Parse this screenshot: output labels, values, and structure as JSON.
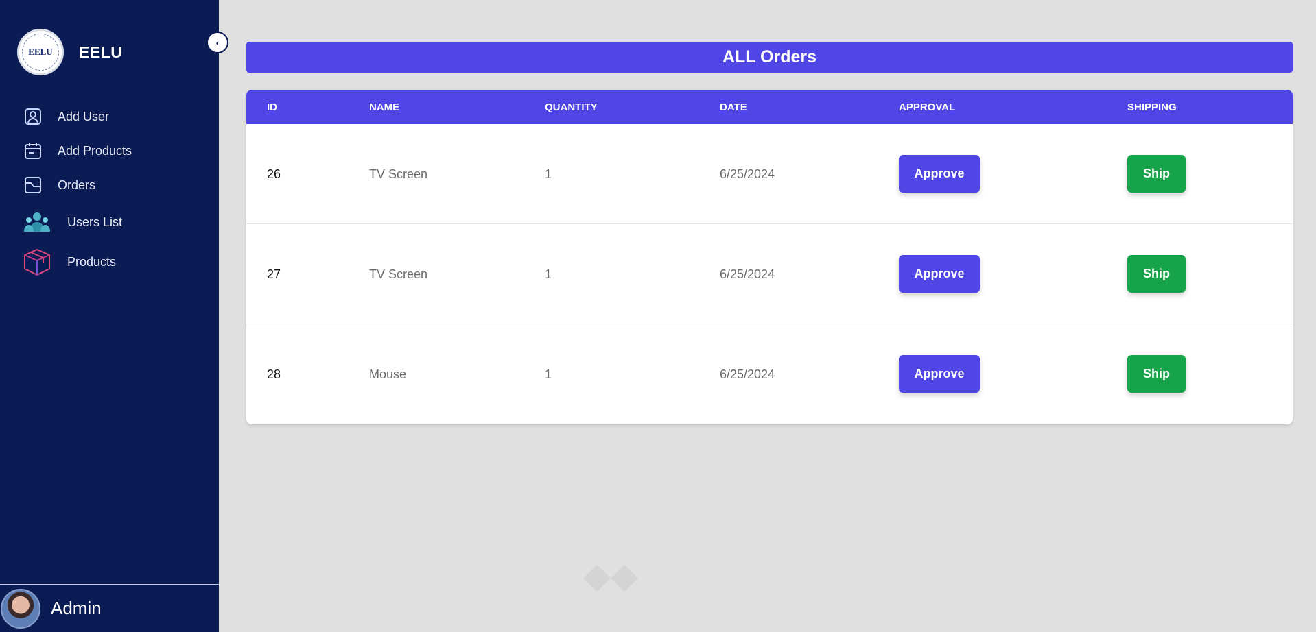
{
  "brand": {
    "name": "EELU",
    "logo_text": "EELU"
  },
  "sidebar": {
    "collapse_icon": "chevron-left-icon",
    "items": [
      {
        "label": "Add User",
        "icon": "user-square-icon"
      },
      {
        "label": "Add Products",
        "icon": "calendar-icon"
      },
      {
        "label": "Orders",
        "icon": "image-frame-icon"
      },
      {
        "label": "Users List",
        "icon": "users-group-icon"
      },
      {
        "label": "Products",
        "icon": "box-icon"
      }
    ]
  },
  "user": {
    "name": "Admin"
  },
  "page": {
    "title": "ALL Orders"
  },
  "table": {
    "columns": [
      "ID",
      "NAME",
      "QUANTITY",
      "DATE",
      "APPROVAL",
      "SHIPPING"
    ],
    "approve_label": "Approve",
    "ship_label": "Ship",
    "rows": [
      {
        "id": "26",
        "name": "TV Screen",
        "quantity": "1",
        "date": "6/25/2024"
      },
      {
        "id": "27",
        "name": "TV Screen",
        "quantity": "1",
        "date": "6/25/2024"
      },
      {
        "id": "28",
        "name": "Mouse",
        "quantity": "1",
        "date": "6/25/2024"
      }
    ]
  },
  "colors": {
    "sidebar": "#0b1b54",
    "accent": "#4f46e5",
    "ship": "#16a34a",
    "background": "#e0e0e0"
  }
}
